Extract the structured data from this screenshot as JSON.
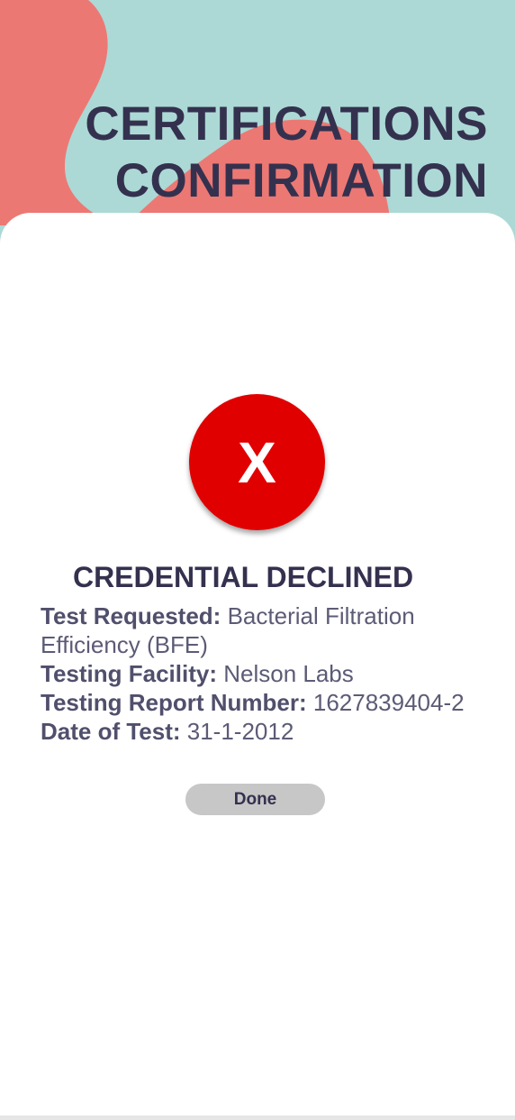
{
  "header": {
    "title_line1": "CERTIFICATIONS",
    "title_line2": "CONFIRMATION"
  },
  "status": {
    "icon": "x-mark-icon",
    "symbol": "X",
    "color": "#e10000",
    "title": "CREDENTIAL DECLINED"
  },
  "details": [
    {
      "label": "Test Requested:",
      "value": "Bacterial Filtration Efficiency (BFE)"
    },
    {
      "label": "Testing Facility:",
      "value": "Nelson Labs"
    },
    {
      "label": "Testing Report Number:",
      "value": "1627839404-2"
    },
    {
      "label": "Date of Test:",
      "value": "31-1-2012"
    }
  ],
  "actions": {
    "done_label": "Done"
  },
  "colors": {
    "teal_background": "#acd9d5",
    "coral_accent": "#ec7874",
    "heading_text": "#34314f",
    "button_gray": "#c7c7c7"
  }
}
